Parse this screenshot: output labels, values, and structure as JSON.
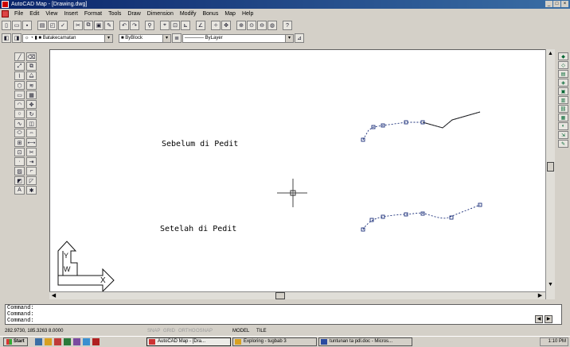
{
  "window": {
    "title": "AutoCAD Map - [Drawing.dwg]",
    "controls": [
      "_",
      "□",
      "×"
    ]
  },
  "menu": [
    "File",
    "Edit",
    "View",
    "Insert",
    "Format",
    "Tools",
    "Draw",
    "Dimension",
    "Modify",
    "Bonus",
    "Map",
    "Help"
  ],
  "layer_toolbar": {
    "layer": "Batakecamatan",
    "color": "ByBlock",
    "linetype": "ByLayer"
  },
  "drawing": {
    "label_before": "Sebelum di Pedit",
    "label_after": "Setelah di Pedit",
    "ucs_y": "Y",
    "ucs_w": "W",
    "ucs_x": "X"
  },
  "command_lines": [
    "Command:",
    "Command:",
    "Command:"
  ],
  "status": {
    "coords": "282.9730, 185.3263 8.0000",
    "modes": [
      "SNAP",
      "GRID",
      "ORTHO",
      "OSNAP"
    ],
    "model": "MODEL",
    "tile": "TILE"
  },
  "taskbar": {
    "start": "Start",
    "tasks": [
      "AutoCAD Map - [Dra...",
      "Exploring - tugbab 3",
      "tuntunan ta pdl.doc - Micros..."
    ],
    "clock": "1:10 PM"
  }
}
